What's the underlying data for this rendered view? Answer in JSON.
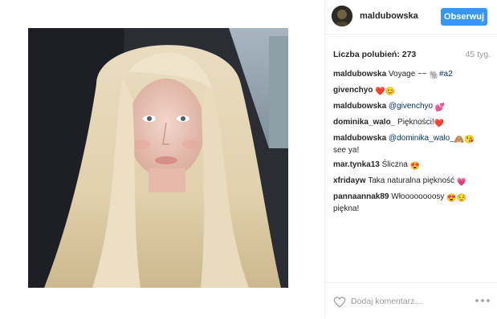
{
  "post": {
    "image_alt": "",
    "author": {
      "username": "maldubowska",
      "follow_label": "Obserwuj"
    },
    "likes_text": "Liczba polubień: 273",
    "time_ago": "45 tyg.",
    "comments": [
      {
        "user": "maldubowska",
        "text": "Voyage ~~ ",
        "emoji": "🐘",
        "tag": "#a2"
      },
      {
        "user": "givenchyo",
        "text": "",
        "emoji": "❤️😊"
      },
      {
        "user": "maldubowska",
        "mention": "@givenchyo",
        "emoji": "💕"
      },
      {
        "user": "dominika_walo_",
        "text": "Piękności!",
        "emoji": "❤️"
      },
      {
        "user": "maldubowska",
        "mention": "@dominika_walo_",
        "emoji": "🙈😘",
        "after": "see ya!"
      },
      {
        "user": "mar.tynka13",
        "text": "Śliczna",
        "emoji": "😍"
      },
      {
        "user": "xfridayw",
        "text": "Taka naturalna piękność",
        "emoji": "💗"
      },
      {
        "user": "pannaannak89",
        "text": "Włoooooooosy",
        "emoji": "😍😌",
        "after": "piękna!"
      }
    ],
    "add_comment_placeholder": "Dodaj komentarz...",
    "icons": {
      "like": "heart-icon",
      "more": "more-options-icon"
    },
    "colors": {
      "follow_button": "#3897f0",
      "mention": "#003569",
      "muted": "#999999"
    }
  }
}
